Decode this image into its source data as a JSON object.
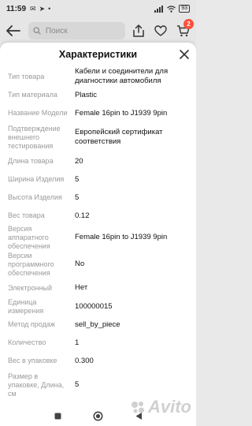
{
  "status_bar": {
    "time": "11:59",
    "battery": "93"
  },
  "header": {
    "search_placeholder": "Поиск",
    "cart_badge": "2"
  },
  "sheet": {
    "title": "Характеристики",
    "rows": [
      {
        "label": "Тип товара",
        "value": "Кабели и соединители для диагностики автомобиля"
      },
      {
        "label": "Тип материала",
        "value": "Plastic"
      },
      {
        "label": "Название Модели",
        "value": "Female 16pin to J1939 9pin"
      },
      {
        "label": "Подтверждение внешнего тестирования",
        "value": "Европейский сертификат соответствия"
      },
      {
        "label": "Длина товара",
        "value": "20"
      },
      {
        "label": "Ширина Изделия",
        "value": "5"
      },
      {
        "label": "Высота Изделия",
        "value": "5"
      },
      {
        "label": "Вес товара",
        "value": "0.12"
      },
      {
        "label": "Версия аппаратного обеспечения",
        "value": "Female 16pin to J1939 9pin"
      },
      {
        "label": "Версии программного обеспечения",
        "value": "No"
      },
      {
        "label": "Электронный",
        "value": "Нет"
      },
      {
        "label": "Единица измерения",
        "value": "100000015"
      },
      {
        "label": "Метод продаж",
        "value": "sell_by_piece"
      },
      {
        "label": "Количество",
        "value": "1"
      },
      {
        "label": "Вес в упаковке",
        "value": "0.300"
      },
      {
        "label": "Размер в упаковке, Длина, см",
        "value": "5"
      }
    ]
  },
  "watermark": "Avito",
  "colors": {
    "badge": "#ff4f3b",
    "label_gray": "#9a9a9a"
  }
}
